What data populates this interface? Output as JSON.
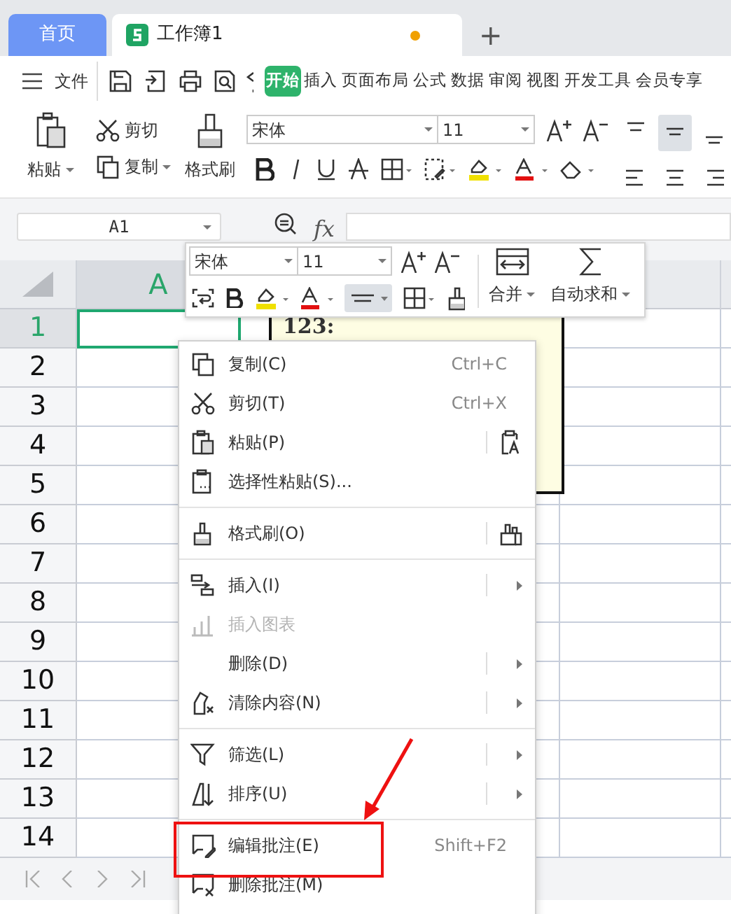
{
  "doc_tabs": [
    {
      "label": "首页",
      "kind": "home",
      "selected": false,
      "unsaved": false
    },
    {
      "label": "工作簿1",
      "kind": "sheet",
      "selected": true,
      "unsaved": true
    }
  ],
  "new_tab": "+",
  "menu": {
    "file": "文件",
    "tabs": [
      {
        "label": "开始",
        "selected": true
      },
      {
        "label": "插入",
        "selected": false
      },
      {
        "label": "页面布局",
        "selected": false
      },
      {
        "label": "公式",
        "selected": false
      },
      {
        "label": "数据",
        "selected": false
      },
      {
        "label": "审阅",
        "selected": false
      },
      {
        "label": "视图",
        "selected": false
      },
      {
        "label": "开发工具",
        "selected": false
      },
      {
        "label": "会员专享",
        "selected": false
      }
    ]
  },
  "ribbon": {
    "paste": "粘贴",
    "cut": "剪切",
    "copy": "复制",
    "format_painter": "格式刷",
    "font": "宋体",
    "size": "11"
  },
  "name_box": "A1",
  "fx": "fx",
  "mini_toolbar": {
    "font": "宋体",
    "size": "11",
    "merge": "合并",
    "autosum": "自动求和"
  },
  "sheet": {
    "columns": [
      {
        "label": "A",
        "selected": true
      }
    ],
    "rows": [
      {
        "label": "1",
        "selected": true
      },
      {
        "label": "2",
        "selected": false
      },
      {
        "label": "3",
        "selected": false
      },
      {
        "label": "4",
        "selected": false
      },
      {
        "label": "5",
        "selected": false
      },
      {
        "label": "6",
        "selected": false
      },
      {
        "label": "7",
        "selected": false
      },
      {
        "label": "8",
        "selected": false
      },
      {
        "label": "9",
        "selected": false
      },
      {
        "label": "10",
        "selected": false
      },
      {
        "label": "11",
        "selected": false
      },
      {
        "label": "12",
        "selected": false
      },
      {
        "label": "13",
        "selected": false
      },
      {
        "label": "14",
        "selected": false
      }
    ]
  },
  "comment": {
    "text": "123:"
  },
  "context_menu": [
    {
      "kind": "item",
      "label": "复制(C)",
      "shortcut": "Ctrl+C",
      "disabled": false,
      "submenu": false,
      "side_action": false,
      "annotated": false
    },
    {
      "kind": "item",
      "label": "剪切(T)",
      "shortcut": "Ctrl+X",
      "disabled": false,
      "submenu": false,
      "side_action": false,
      "annotated": false
    },
    {
      "kind": "item",
      "label": "粘贴(P)",
      "disabled": false,
      "submenu": false,
      "side_action": true,
      "annotated": false
    },
    {
      "kind": "item",
      "label": "选择性粘贴(S)...",
      "disabled": false,
      "submenu": false,
      "side_action": false,
      "annotated": false
    },
    {
      "kind": "divider"
    },
    {
      "kind": "item",
      "label": "格式刷(O)",
      "disabled": false,
      "submenu": false,
      "side_action": true,
      "annotated": false
    },
    {
      "kind": "divider"
    },
    {
      "kind": "item",
      "label": "插入(I)",
      "disabled": false,
      "submenu": true,
      "side_action": false,
      "annotated": false
    },
    {
      "kind": "item",
      "label": "插入图表",
      "disabled": true,
      "submenu": false,
      "side_action": false,
      "annotated": false
    },
    {
      "kind": "item",
      "label": "删除(D)",
      "disabled": false,
      "submenu": true,
      "side_action": false,
      "annotated": false
    },
    {
      "kind": "item",
      "label": "清除内容(N)",
      "disabled": false,
      "submenu": true,
      "side_action": false,
      "annotated": false
    },
    {
      "kind": "divider"
    },
    {
      "kind": "item",
      "label": "筛选(L)",
      "disabled": false,
      "submenu": true,
      "side_action": false,
      "annotated": false
    },
    {
      "kind": "item",
      "label": "排序(U)",
      "disabled": false,
      "submenu": true,
      "side_action": false,
      "annotated": false
    },
    {
      "kind": "divider"
    },
    {
      "kind": "item",
      "label": "编辑批注(E)",
      "shortcut": "Shift+F2",
      "disabled": false,
      "submenu": false,
      "side_action": false,
      "annotated": true
    },
    {
      "kind": "item",
      "label": "删除批注(M)",
      "disabled": false,
      "submenu": false,
      "side_action": false,
      "annotated": false
    }
  ]
}
